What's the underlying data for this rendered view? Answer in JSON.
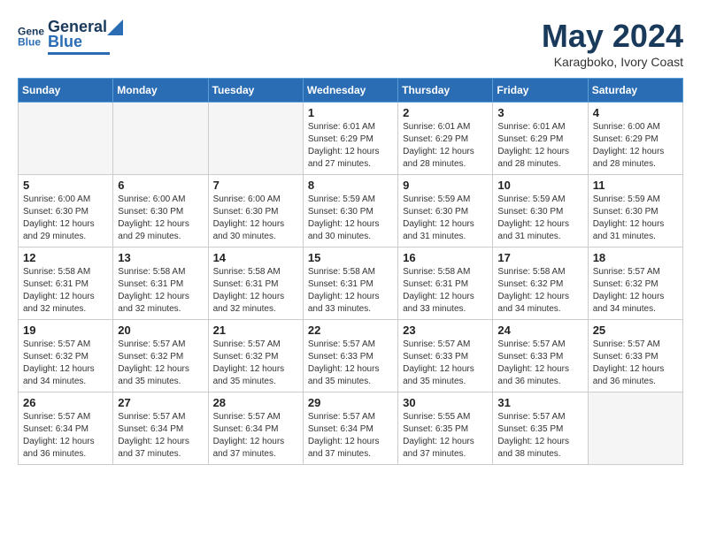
{
  "header": {
    "logo": {
      "line1": "General",
      "line2": "Blue"
    },
    "title": "May 2024",
    "subtitle": "Karagboko, Ivory Coast"
  },
  "weekdays": [
    "Sunday",
    "Monday",
    "Tuesday",
    "Wednesday",
    "Thursday",
    "Friday",
    "Saturday"
  ],
  "weeks": [
    [
      {
        "day": "",
        "sunrise": "",
        "sunset": "",
        "daylight": ""
      },
      {
        "day": "",
        "sunrise": "",
        "sunset": "",
        "daylight": ""
      },
      {
        "day": "",
        "sunrise": "",
        "sunset": "",
        "daylight": ""
      },
      {
        "day": "1",
        "sunrise": "Sunrise: 6:01 AM",
        "sunset": "Sunset: 6:29 PM",
        "daylight": "Daylight: 12 hours and 27 minutes."
      },
      {
        "day": "2",
        "sunrise": "Sunrise: 6:01 AM",
        "sunset": "Sunset: 6:29 PM",
        "daylight": "Daylight: 12 hours and 28 minutes."
      },
      {
        "day": "3",
        "sunrise": "Sunrise: 6:01 AM",
        "sunset": "Sunset: 6:29 PM",
        "daylight": "Daylight: 12 hours and 28 minutes."
      },
      {
        "day": "4",
        "sunrise": "Sunrise: 6:00 AM",
        "sunset": "Sunset: 6:29 PM",
        "daylight": "Daylight: 12 hours and 28 minutes."
      }
    ],
    [
      {
        "day": "5",
        "sunrise": "Sunrise: 6:00 AM",
        "sunset": "Sunset: 6:30 PM",
        "daylight": "Daylight: 12 hours and 29 minutes."
      },
      {
        "day": "6",
        "sunrise": "Sunrise: 6:00 AM",
        "sunset": "Sunset: 6:30 PM",
        "daylight": "Daylight: 12 hours and 29 minutes."
      },
      {
        "day": "7",
        "sunrise": "Sunrise: 6:00 AM",
        "sunset": "Sunset: 6:30 PM",
        "daylight": "Daylight: 12 hours and 30 minutes."
      },
      {
        "day": "8",
        "sunrise": "Sunrise: 5:59 AM",
        "sunset": "Sunset: 6:30 PM",
        "daylight": "Daylight: 12 hours and 30 minutes."
      },
      {
        "day": "9",
        "sunrise": "Sunrise: 5:59 AM",
        "sunset": "Sunset: 6:30 PM",
        "daylight": "Daylight: 12 hours and 31 minutes."
      },
      {
        "day": "10",
        "sunrise": "Sunrise: 5:59 AM",
        "sunset": "Sunset: 6:30 PM",
        "daylight": "Daylight: 12 hours and 31 minutes."
      },
      {
        "day": "11",
        "sunrise": "Sunrise: 5:59 AM",
        "sunset": "Sunset: 6:30 PM",
        "daylight": "Daylight: 12 hours and 31 minutes."
      }
    ],
    [
      {
        "day": "12",
        "sunrise": "Sunrise: 5:58 AM",
        "sunset": "Sunset: 6:31 PM",
        "daylight": "Daylight: 12 hours and 32 minutes."
      },
      {
        "day": "13",
        "sunrise": "Sunrise: 5:58 AM",
        "sunset": "Sunset: 6:31 PM",
        "daylight": "Daylight: 12 hours and 32 minutes."
      },
      {
        "day": "14",
        "sunrise": "Sunrise: 5:58 AM",
        "sunset": "Sunset: 6:31 PM",
        "daylight": "Daylight: 12 hours and 32 minutes."
      },
      {
        "day": "15",
        "sunrise": "Sunrise: 5:58 AM",
        "sunset": "Sunset: 6:31 PM",
        "daylight": "Daylight: 12 hours and 33 minutes."
      },
      {
        "day": "16",
        "sunrise": "Sunrise: 5:58 AM",
        "sunset": "Sunset: 6:31 PM",
        "daylight": "Daylight: 12 hours and 33 minutes."
      },
      {
        "day": "17",
        "sunrise": "Sunrise: 5:58 AM",
        "sunset": "Sunset: 6:32 PM",
        "daylight": "Daylight: 12 hours and 34 minutes."
      },
      {
        "day": "18",
        "sunrise": "Sunrise: 5:57 AM",
        "sunset": "Sunset: 6:32 PM",
        "daylight": "Daylight: 12 hours and 34 minutes."
      }
    ],
    [
      {
        "day": "19",
        "sunrise": "Sunrise: 5:57 AM",
        "sunset": "Sunset: 6:32 PM",
        "daylight": "Daylight: 12 hours and 34 minutes."
      },
      {
        "day": "20",
        "sunrise": "Sunrise: 5:57 AM",
        "sunset": "Sunset: 6:32 PM",
        "daylight": "Daylight: 12 hours and 35 minutes."
      },
      {
        "day": "21",
        "sunrise": "Sunrise: 5:57 AM",
        "sunset": "Sunset: 6:32 PM",
        "daylight": "Daylight: 12 hours and 35 minutes."
      },
      {
        "day": "22",
        "sunrise": "Sunrise: 5:57 AM",
        "sunset": "Sunset: 6:33 PM",
        "daylight": "Daylight: 12 hours and 35 minutes."
      },
      {
        "day": "23",
        "sunrise": "Sunrise: 5:57 AM",
        "sunset": "Sunset: 6:33 PM",
        "daylight": "Daylight: 12 hours and 35 minutes."
      },
      {
        "day": "24",
        "sunrise": "Sunrise: 5:57 AM",
        "sunset": "Sunset: 6:33 PM",
        "daylight": "Daylight: 12 hours and 36 minutes."
      },
      {
        "day": "25",
        "sunrise": "Sunrise: 5:57 AM",
        "sunset": "Sunset: 6:33 PM",
        "daylight": "Daylight: 12 hours and 36 minutes."
      }
    ],
    [
      {
        "day": "26",
        "sunrise": "Sunrise: 5:57 AM",
        "sunset": "Sunset: 6:34 PM",
        "daylight": "Daylight: 12 hours and 36 minutes."
      },
      {
        "day": "27",
        "sunrise": "Sunrise: 5:57 AM",
        "sunset": "Sunset: 6:34 PM",
        "daylight": "Daylight: 12 hours and 37 minutes."
      },
      {
        "day": "28",
        "sunrise": "Sunrise: 5:57 AM",
        "sunset": "Sunset: 6:34 PM",
        "daylight": "Daylight: 12 hours and 37 minutes."
      },
      {
        "day": "29",
        "sunrise": "Sunrise: 5:57 AM",
        "sunset": "Sunset: 6:34 PM",
        "daylight": "Daylight: 12 hours and 37 minutes."
      },
      {
        "day": "30",
        "sunrise": "Sunrise: 5:55 AM",
        "sunset": "Sunset: 6:35 PM",
        "daylight": "Daylight: 12 hours and 37 minutes."
      },
      {
        "day": "31",
        "sunrise": "Sunrise: 5:57 AM",
        "sunset": "Sunset: 6:35 PM",
        "daylight": "Daylight: 12 hours and 38 minutes."
      },
      {
        "day": "",
        "sunrise": "",
        "sunset": "",
        "daylight": ""
      }
    ]
  ]
}
